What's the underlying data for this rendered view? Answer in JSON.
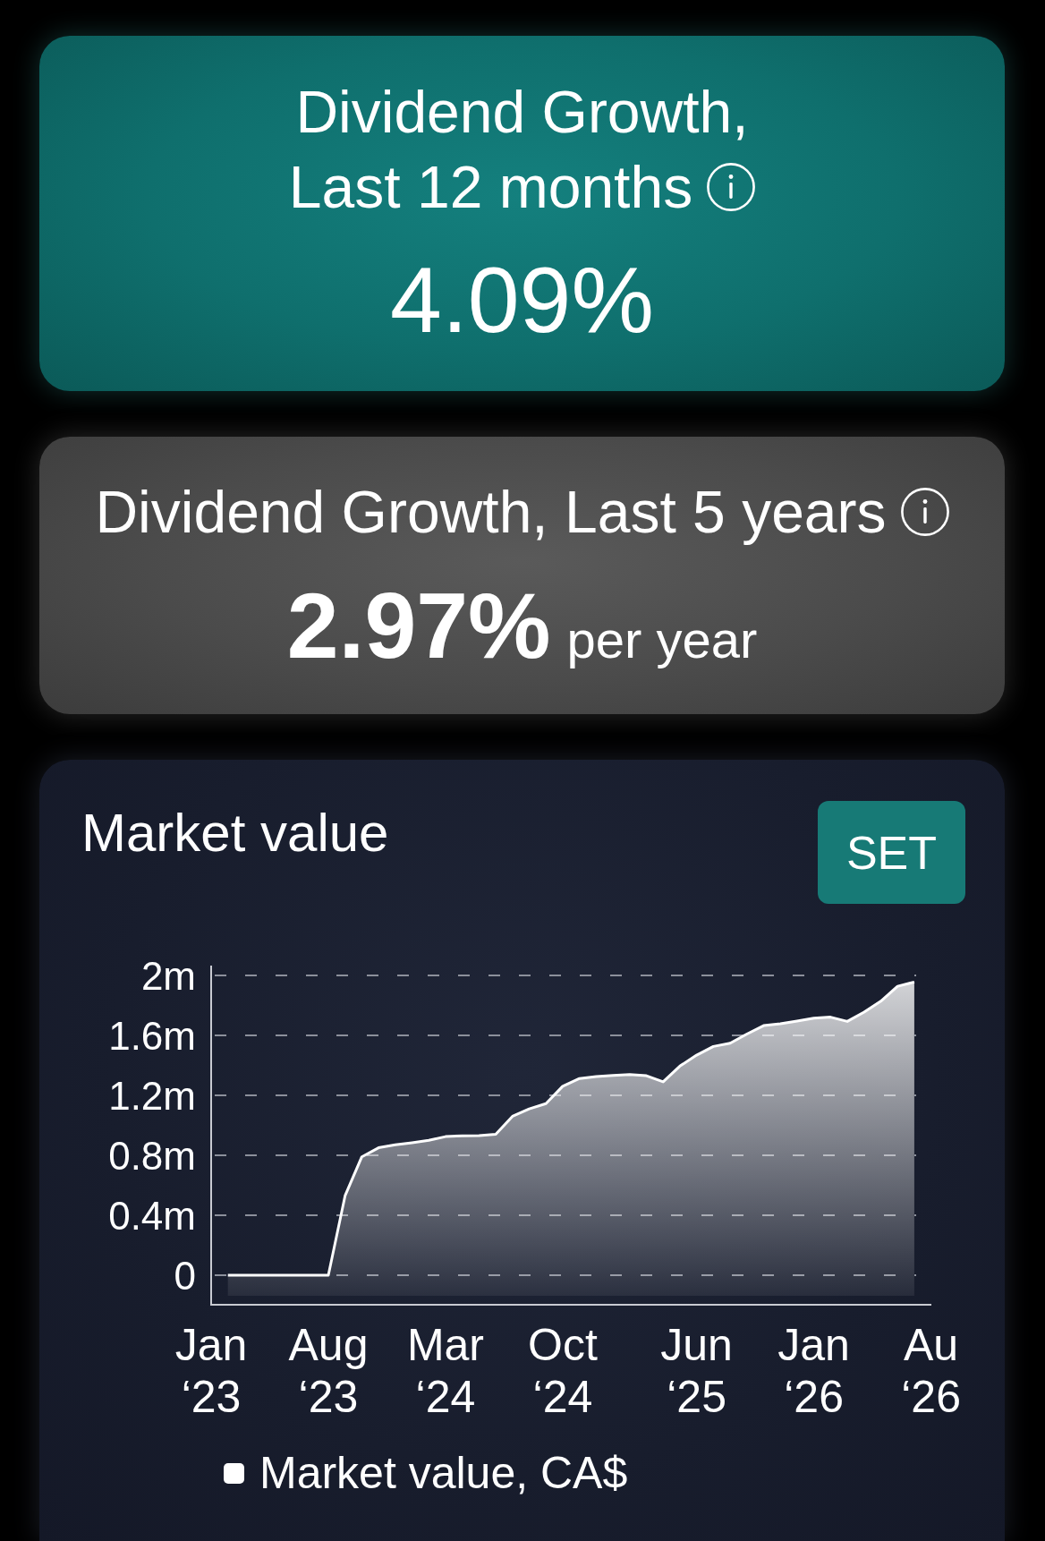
{
  "cards": [
    {
      "kind": "highlight",
      "title_lines": [
        "Dividend Growth,",
        "Last 12 months"
      ],
      "info": true,
      "value": "4.09%"
    },
    {
      "kind": "metric",
      "title_lines": [
        "Dividend Growth, Last 5 years"
      ],
      "info": true,
      "value": "2.97%",
      "unit": "per year"
    },
    {
      "kind": "chart",
      "title": "Market value",
      "button": "SET",
      "chart_data": {
        "type": "area",
        "grid": true,
        "categories": [
          "Jan ‘23",
          null,
          null,
          null,
          null,
          null,
          null,
          "Aug ‘23",
          null,
          null,
          null,
          null,
          null,
          null,
          "Mar ‘24",
          null,
          null,
          null,
          null,
          null,
          null,
          "Oct ‘24",
          null,
          null,
          null,
          null,
          null,
          null,
          null,
          "Jun ‘25",
          null,
          null,
          null,
          null,
          null,
          null,
          "Jan ‘26",
          null,
          null,
          null,
          null,
          null,
          null,
          "Au ‘26"
        ],
        "series": [
          {
            "name": "Market value, CA$",
            "color": "#ffffff",
            "values": [
              null,
              0,
              0,
              0,
              0,
              0,
              0,
              0,
              0.53,
              0.79,
              0.85,
              0.87,
              0.884,
              0.9,
              0.925,
              0.93,
              0.932,
              0.94,
              1.06,
              1.11,
              1.145,
              1.26,
              1.312,
              1.325,
              1.333,
              1.339,
              1.331,
              1.29,
              1.395,
              1.468,
              1.526,
              1.548,
              1.609,
              1.665,
              1.678,
              1.696,
              1.715,
              1.722,
              1.693,
              1.755,
              1.828,
              1.928,
              1.956,
              null
            ]
          }
        ],
        "ylim": [
          0,
          2
        ],
        "yticks": [
          {
            "value": 0,
            "label": "0"
          },
          {
            "value": 0.4,
            "label": "0.4m"
          },
          {
            "value": 0.8,
            "label": "0.8m"
          },
          {
            "value": 1.2,
            "label": "1.2m"
          },
          {
            "value": 1.6,
            "label": "1.6m"
          },
          {
            "value": 2,
            "label": "2m"
          }
        ]
      }
    }
  ]
}
